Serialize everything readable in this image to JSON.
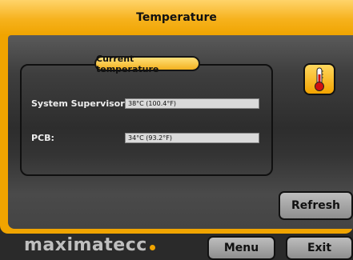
{
  "header": {
    "title": "Temperature"
  },
  "panel": {
    "legend": "Current temperature",
    "rows": [
      {
        "label": "System Supervisor:",
        "value": "38°C (100.4°F)"
      },
      {
        "label": "PCB:",
        "value": "34°C (93.2°F)"
      }
    ]
  },
  "icons": {
    "thermometer": "thermometer-icon"
  },
  "buttons": {
    "refresh": "Refresh",
    "menu": "Menu",
    "exit": "Exit"
  },
  "brand": {
    "logo": "maximatecc"
  },
  "colors": {
    "accent": "#f0a400",
    "background": "#2a2a2a"
  }
}
